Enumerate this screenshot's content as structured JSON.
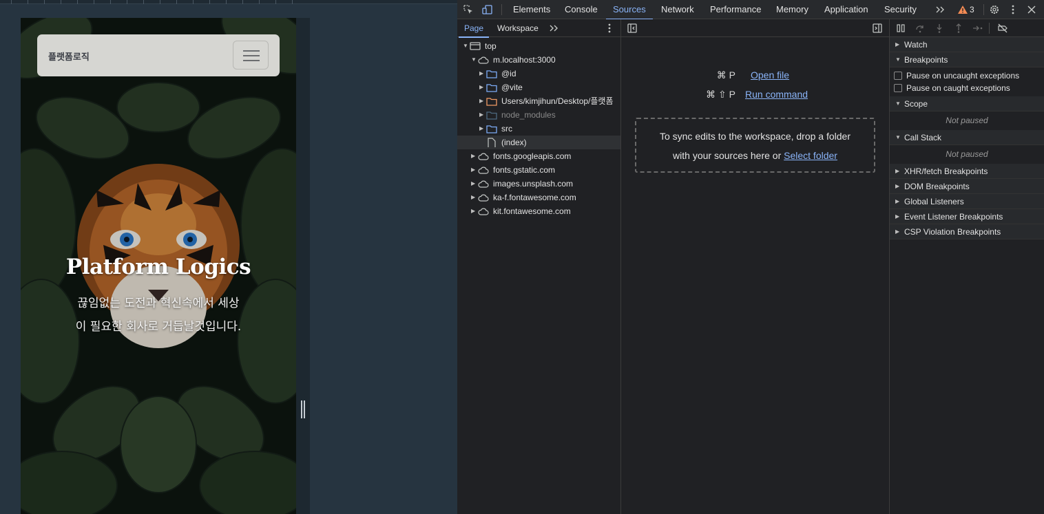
{
  "viewport": {
    "brand": "플랫폼로직",
    "hero_title": "Platform Logics",
    "hero_subtitle": "끊임없는 도전과 혁신속에서 세상이 필요한 회사로 거듭날것입니다."
  },
  "devtools": {
    "tabs": [
      "Elements",
      "Console",
      "Sources",
      "Network",
      "Performance",
      "Memory",
      "Application",
      "Security"
    ],
    "active_tab": "Sources",
    "warning_count": "3",
    "navigator": {
      "tabs": [
        "Page",
        "Workspace"
      ],
      "active_tab": "Page",
      "tree": [
        {
          "label": "top",
          "depth": 0,
          "icon": "frame-icon",
          "expanded": true
        },
        {
          "label": "m.localhost:3000",
          "depth": 1,
          "icon": "cloud-icon",
          "expanded": true
        },
        {
          "label": "@id",
          "depth": 2,
          "icon": "folder-icon",
          "expanded": false
        },
        {
          "label": "@vite",
          "depth": 2,
          "icon": "folder-icon",
          "expanded": false
        },
        {
          "label": "Users/kimjihun/Desktop/플랫폼",
          "depth": 2,
          "icon": "folder-orange-icon",
          "expanded": false
        },
        {
          "label": "node_modules",
          "depth": 2,
          "icon": "folder-dim-icon",
          "expanded": false
        },
        {
          "label": "src",
          "depth": 2,
          "icon": "folder-icon",
          "expanded": false
        },
        {
          "label": "(index)",
          "depth": 2,
          "icon": "file-icon",
          "expanded": null
        },
        {
          "label": "fonts.googleapis.com",
          "depth": 1,
          "icon": "cloud-icon",
          "expanded": false
        },
        {
          "label": "fonts.gstatic.com",
          "depth": 1,
          "icon": "cloud-icon",
          "expanded": false
        },
        {
          "label": "images.unsplash.com",
          "depth": 1,
          "icon": "cloud-icon",
          "expanded": false
        },
        {
          "label": "ka-f.fontawesome.com",
          "depth": 1,
          "icon": "cloud-icon",
          "expanded": false
        },
        {
          "label": "kit.fontawesome.com",
          "depth": 1,
          "icon": "cloud-icon",
          "expanded": false
        }
      ]
    },
    "editor": {
      "open_file_keys": "⌘ P",
      "open_file_label": "Open file",
      "run_command_keys": "⌘ ⇧ P",
      "run_command_label": "Run command",
      "dropzone_text_1": "To sync edits to the workspace, drop a folder",
      "dropzone_text_2": "with your sources here or",
      "dropzone_link": "Select folder"
    },
    "debugger": {
      "watch": "Watch",
      "breakpoints": "Breakpoints",
      "pause_uncaught": "Pause on uncaught exceptions",
      "pause_caught": "Pause on caught exceptions",
      "scope": "Scope",
      "scope_status": "Not paused",
      "call_stack": "Call Stack",
      "call_stack_status": "Not paused",
      "sections": [
        "XHR/fetch Breakpoints",
        "DOM Breakpoints",
        "Global Listeners",
        "Event Listener Breakpoints",
        "CSP Violation Breakpoints"
      ]
    }
  }
}
